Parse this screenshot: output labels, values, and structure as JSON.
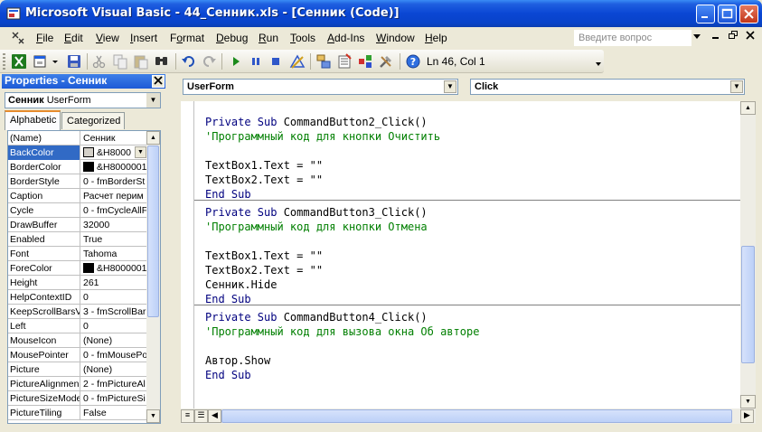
{
  "window": {
    "title": "Microsoft Visual Basic - 44_Сенник.xls - [Сенник (Code)]",
    "controls": [
      "_",
      "□",
      "✕"
    ]
  },
  "menubar": {
    "items": [
      {
        "label": "File",
        "underline": "F",
        "rest": "ile"
      },
      {
        "label": "Edit",
        "underline": "E",
        "rest": "dit"
      },
      {
        "label": "View",
        "underline": "V",
        "rest": "iew"
      },
      {
        "label": "Insert",
        "underline": "I",
        "rest": "nsert"
      },
      {
        "label": "Format",
        "underline": "o",
        "pre": "F",
        "rest": "rmat"
      },
      {
        "label": "Debug",
        "underline": "D",
        "rest": "ebug"
      },
      {
        "label": "Run",
        "underline": "R",
        "rest": "un"
      },
      {
        "label": "Tools",
        "underline": "T",
        "rest": "ools"
      },
      {
        "label": "Add-Ins",
        "underline": "A",
        "rest": "dd-Ins"
      },
      {
        "label": "Window",
        "underline": "W",
        "rest": "indow"
      },
      {
        "label": "Help",
        "underline": "H",
        "rest": "elp"
      }
    ],
    "ask_placeholder": "Введите вопрос",
    "mdi_controls": [
      "✕",
      "⧉",
      "✕"
    ]
  },
  "toolbar": {
    "position_text": "Ln 46, Col 1",
    "icons": [
      "excel-icon",
      "insert-userform-icon",
      "save-icon",
      "cut-icon",
      "copy-icon",
      "paste-icon",
      "find-icon",
      "undo-icon",
      "redo-icon",
      "run-icon",
      "break-icon",
      "reset-icon",
      "design-mode-icon",
      "project-explorer-icon",
      "properties-icon",
      "object-browser-icon",
      "toolbox-icon",
      "help-icon"
    ]
  },
  "properties": {
    "title": "Properties - Сенник",
    "object_name": "Сенник",
    "object_type": "UserForm",
    "tabs": [
      "Alphabetic",
      "Categorized"
    ],
    "rows": [
      {
        "name": "(Name)",
        "value": "Сенник"
      },
      {
        "name": "BackColor",
        "value": "&H8000",
        "swatch": "#d4d0c8",
        "selected": true
      },
      {
        "name": "BorderColor",
        "value": "&H8000001",
        "swatch": "#000000"
      },
      {
        "name": "BorderStyle",
        "value": "0 - fmBorderSt"
      },
      {
        "name": "Caption",
        "value": "Расчет перим"
      },
      {
        "name": "Cycle",
        "value": "0 - fmCycleAllF"
      },
      {
        "name": "DrawBuffer",
        "value": "32000"
      },
      {
        "name": "Enabled",
        "value": "True"
      },
      {
        "name": "Font",
        "value": "Tahoma"
      },
      {
        "name": "ForeColor",
        "value": "&H8000001",
        "swatch": "#000000"
      },
      {
        "name": "Height",
        "value": "261"
      },
      {
        "name": "HelpContextID",
        "value": "0"
      },
      {
        "name": "KeepScrollBarsV",
        "value": "3 - fmScrollBar"
      },
      {
        "name": "Left",
        "value": "0"
      },
      {
        "name": "MouseIcon",
        "value": "(None)"
      },
      {
        "name": "MousePointer",
        "value": "0 - fmMousePo"
      },
      {
        "name": "Picture",
        "value": "(None)"
      },
      {
        "name": "PictureAlignmen",
        "value": "2 - fmPictureAl"
      },
      {
        "name": "PictureSizeMode",
        "value": "0 - fmPictureSi"
      },
      {
        "name": "PictureTiling",
        "value": "False"
      }
    ]
  },
  "code_window": {
    "object_combo": "UserForm",
    "procedure_combo": "Click",
    "lines": [
      {
        "kind": "proc",
        "keyword": "Private Sub",
        "text": " CommandButton2_Click()"
      },
      {
        "kind": "comment",
        "text": "'Программный код для кнопки Очистить"
      },
      {
        "kind": "blank",
        "text": ""
      },
      {
        "kind": "code",
        "text": "TextBox1.Text = \"\""
      },
      {
        "kind": "code",
        "text": "TextBox2.Text = \"\""
      },
      {
        "kind": "end",
        "text": "End Sub"
      },
      {
        "kind": "proc",
        "keyword": "Private Sub",
        "text": " CommandButton3_Click()"
      },
      {
        "kind": "comment",
        "text": "'Программный код для кнопки Отмена"
      },
      {
        "kind": "blank",
        "text": ""
      },
      {
        "kind": "code",
        "text": "TextBox1.Text = \"\""
      },
      {
        "kind": "code",
        "text": "TextBox2.Text = \"\""
      },
      {
        "kind": "code",
        "text": "Сенник.Hide"
      },
      {
        "kind": "end",
        "text": "End Sub"
      },
      {
        "kind": "proc",
        "keyword": "Private Sub",
        "text": " CommandButton4_Click()"
      },
      {
        "kind": "comment",
        "text": "'Программный код для вызова окна Об авторе"
      },
      {
        "kind": "blank",
        "text": ""
      },
      {
        "kind": "code",
        "text": "Автор.Show"
      },
      {
        "kind": "end",
        "text": "End Sub"
      }
    ]
  }
}
